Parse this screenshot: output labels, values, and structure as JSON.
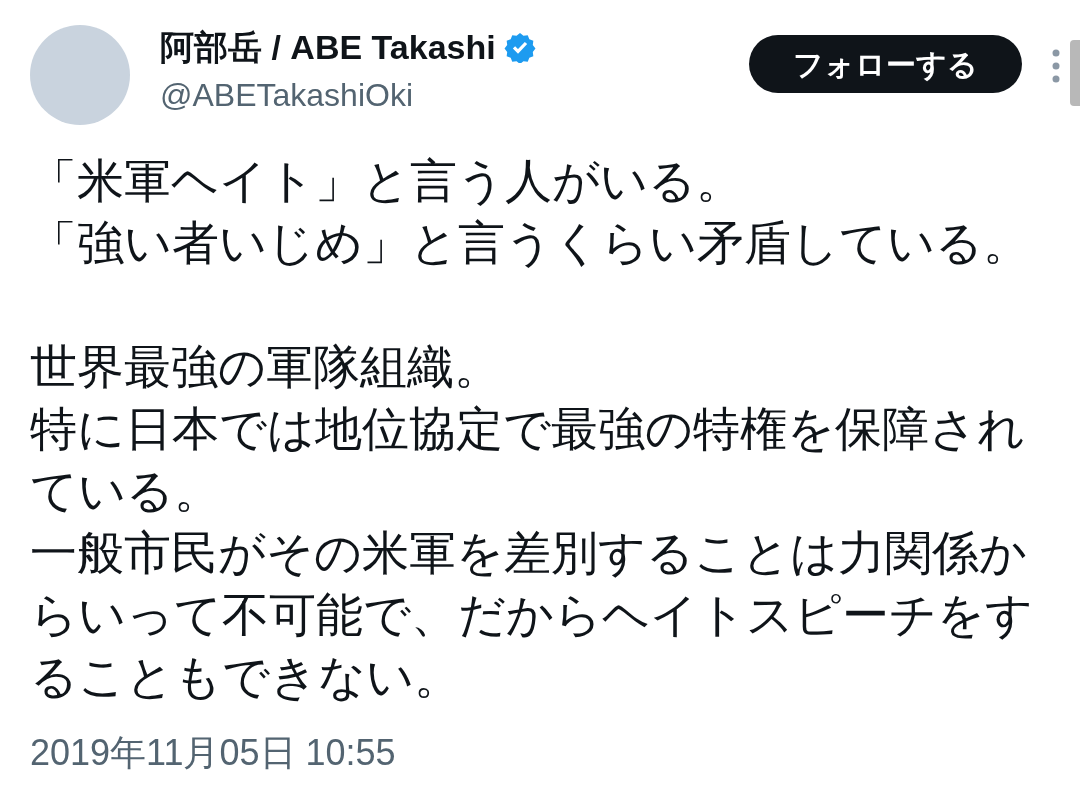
{
  "author": {
    "name": "阿部岳 / ABE Takashi",
    "verified": true,
    "handle": "@ABETakashiOki"
  },
  "follow_button": {
    "label": "フォローする"
  },
  "tweet": {
    "paragraphs": [
      [
        "「米軍ヘイト」と言う人がいる。",
        "「強い者いじめ」と言うくらい矛盾している。"
      ],
      [
        "世界最強の軍隊組織。",
        "特に日本では地位協定で最強の特権を保障され",
        "ている。",
        "一般市民がその米軍を差別することは力関係か",
        "らいって不可能で、だからヘイトスピーチをす",
        "ることもできない。"
      ]
    ],
    "timestamp": "2019年11月05日 10:55"
  }
}
